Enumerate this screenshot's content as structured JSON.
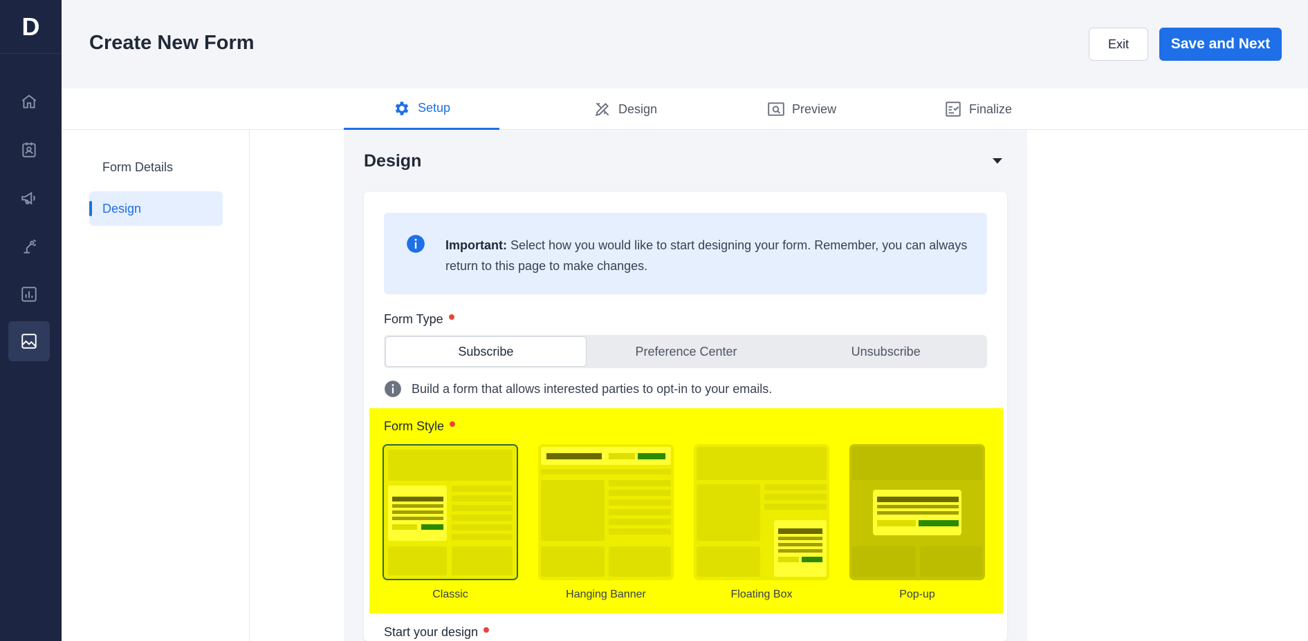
{
  "app": {
    "logo_letter": "D"
  },
  "rail": {
    "items": [
      {
        "icon": "home-icon"
      },
      {
        "icon": "contacts-icon"
      },
      {
        "icon": "megaphone-icon"
      },
      {
        "icon": "automation-icon"
      },
      {
        "icon": "reports-icon"
      },
      {
        "icon": "image-icon",
        "active": true
      }
    ]
  },
  "header": {
    "title": "Create New Form",
    "exit_label": "Exit",
    "save_label": "Save and Next"
  },
  "tabs": [
    {
      "label": "Setup",
      "icon": "gear-icon",
      "active": true
    },
    {
      "label": "Design",
      "icon": "design-tools-icon"
    },
    {
      "label": "Preview",
      "icon": "preview-icon"
    },
    {
      "label": "Finalize",
      "icon": "checklist-icon"
    }
  ],
  "subnav": [
    {
      "label": "Form Details"
    },
    {
      "label": "Design",
      "active": true
    }
  ],
  "section": {
    "title": "Design",
    "alert": {
      "strong": "Important:",
      "text": " Select how you would like to start designing your form. Remember, you can always return to this page to make changes."
    },
    "form_type": {
      "label": "Form Type",
      "options": [
        "Subscribe",
        "Preference Center",
        "Unsubscribe"
      ],
      "selected": "Subscribe",
      "hint": "Build a form that allows interested parties to opt-in to your emails."
    },
    "form_style": {
      "label": "Form Style",
      "options": [
        "Classic",
        "Hanging Banner",
        "Floating Box",
        "Pop-up"
      ],
      "selected": "Classic"
    },
    "start_design": {
      "label": "Start your design"
    }
  },
  "colors": {
    "accent": "#1e6fe8",
    "rail_bg": "#1c2541",
    "highlight": "#ffff00",
    "required_dot": "#e5483b"
  }
}
